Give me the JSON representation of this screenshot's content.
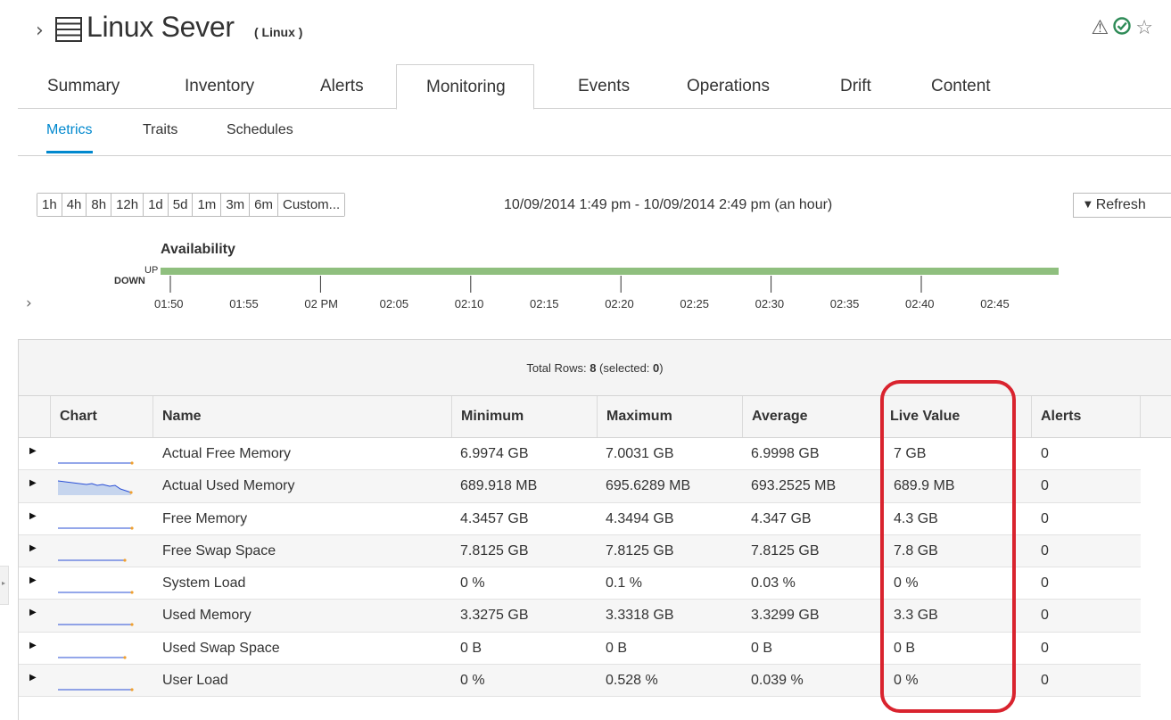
{
  "header": {
    "title": "Linux Sever",
    "subtitle": "( Linux )",
    "icons": [
      "warning-icon",
      "available-check-icon",
      "favorite-star-icon"
    ]
  },
  "tabs": [
    {
      "label": "Summary",
      "active": false
    },
    {
      "label": "Inventory",
      "active": false
    },
    {
      "label": "Alerts",
      "active": false
    },
    {
      "label": "Monitoring",
      "active": true
    },
    {
      "label": "Events",
      "active": false
    },
    {
      "label": "Operations",
      "active": false
    },
    {
      "label": "Drift",
      "active": false
    },
    {
      "label": "Content",
      "active": false
    }
  ],
  "subtabs": [
    {
      "label": "Metrics",
      "active": true
    },
    {
      "label": "Traits",
      "active": false
    },
    {
      "label": "Schedules",
      "active": false
    }
  ],
  "range_buttons": [
    "1h",
    "4h",
    "8h",
    "12h",
    "1d",
    "5d",
    "1m",
    "3m",
    "6m",
    "Custom..."
  ],
  "time_range": "10/09/2014 1:49 pm - 10/09/2014 2:49 pm (an hour)",
  "refresh_label": "Refresh",
  "availability": {
    "title": "Availability",
    "up_label": "UP",
    "down_label": "DOWN",
    "state": "UP",
    "ticks": [
      "01:50",
      "01:55",
      "02 PM",
      "02:05",
      "02:10",
      "02:15",
      "02:20",
      "02:25",
      "02:30",
      "02:35",
      "02:40",
      "02:45"
    ],
    "color": "#8fbf7e"
  },
  "grid": {
    "total_rows_label": "Total Rows: ",
    "total_rows": "8",
    "selected_label": " (selected: ",
    "selected": "0",
    "selected_close": ")",
    "columns": [
      "Chart",
      "Name",
      "Minimum",
      "Maximum",
      "Average",
      "Live Value",
      "Alerts"
    ],
    "rows": [
      {
        "name": "Actual Free Memory",
        "min": "6.9974 GB",
        "max": "7.0031 GB",
        "avg": "6.9998 GB",
        "live": "7 GB",
        "alerts": "0"
      },
      {
        "name": "Actual Used Memory",
        "min": "689.918 MB",
        "max": "695.6289 MB",
        "avg": "693.2525 MB",
        "live": "689.9 MB",
        "alerts": "0"
      },
      {
        "name": "Free Memory",
        "min": "4.3457 GB",
        "max": "4.3494 GB",
        "avg": "4.347 GB",
        "live": "4.3 GB",
        "alerts": "0"
      },
      {
        "name": "Free Swap Space",
        "min": "7.8125 GB",
        "max": "7.8125 GB",
        "avg": "7.8125 GB",
        "live": "7.8 GB",
        "alerts": "0"
      },
      {
        "name": "System Load",
        "min": "0 %",
        "max": "0.1 %",
        "avg": "0.03 %",
        "live": "0 %",
        "alerts": "0"
      },
      {
        "name": "Used Memory",
        "min": "3.3275 GB",
        "max": "3.3318 GB",
        "avg": "3.3299 GB",
        "live": "3.3 GB",
        "alerts": "0"
      },
      {
        "name": "Used Swap Space",
        "min": "0 B",
        "max": "0 B",
        "avg": "0 B",
        "live": "0 B",
        "alerts": "0"
      },
      {
        "name": "User Load",
        "min": "0 %",
        "max": "0.528 %",
        "avg": "0.039 %",
        "live": "0 %",
        "alerts": "0"
      }
    ]
  },
  "colors": {
    "accent": "#0088ce",
    "availability_up": "#8fbf7e",
    "sparkline": "#2a4fd6",
    "sparkline_end": "#f0a030",
    "highlight": "#d9232e"
  }
}
